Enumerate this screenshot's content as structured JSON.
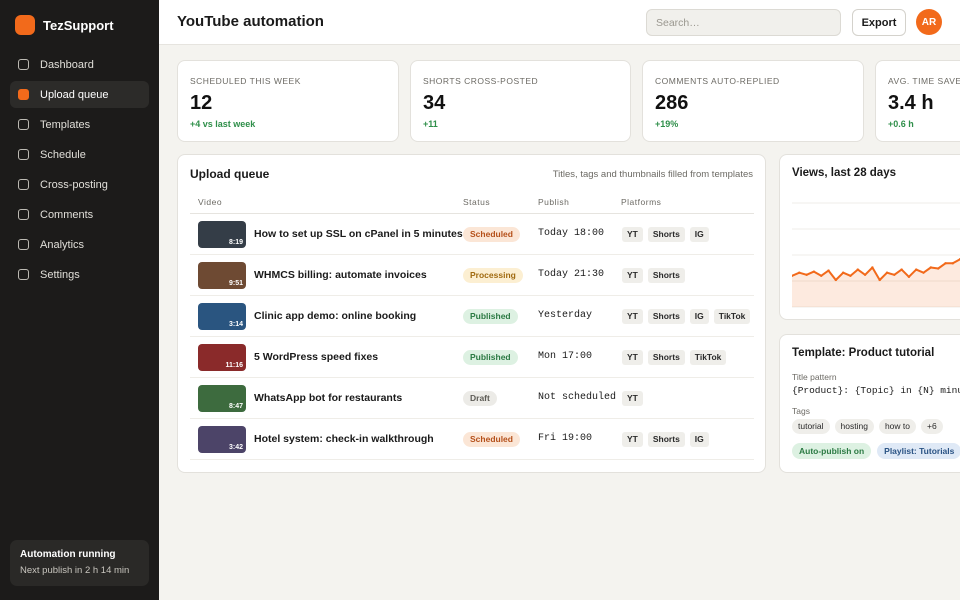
{
  "brand": {
    "name": "TezSupport",
    "accent": "#f26a1b"
  },
  "sidebar": {
    "items": [
      {
        "label": "Dashboard",
        "active": false
      },
      {
        "label": "Upload queue",
        "active": true
      },
      {
        "label": "Templates",
        "active": false
      },
      {
        "label": "Schedule",
        "active": false
      },
      {
        "label": "Cross-posting",
        "active": false
      },
      {
        "label": "Comments",
        "active": false
      },
      {
        "label": "Analytics",
        "active": false
      },
      {
        "label": "Settings",
        "active": false
      }
    ],
    "status": {
      "title": "Automation running",
      "subtitle": "Next publish in 2 h 14 min"
    }
  },
  "header": {
    "title": "YouTube automation",
    "search_placeholder": "Search…",
    "export_label": "Export",
    "avatar_initials": "AR"
  },
  "stats": [
    {
      "label": "Scheduled this week",
      "value": "12",
      "delta": "+4 vs last week"
    },
    {
      "label": "Shorts cross-posted",
      "value": "34",
      "delta": "+11"
    },
    {
      "label": "Comments auto-replied",
      "value": "286",
      "delta": "+19%"
    },
    {
      "label": "Avg. time saved",
      "value": "3.4 h",
      "delta": "+0.6 h"
    }
  ],
  "queue": {
    "title": "Upload queue",
    "note": "Titles, tags and thumbnails filled from templates",
    "columns": [
      "Video",
      "Status",
      "Publish",
      "Platforms"
    ],
    "rows": [
      {
        "title": "How to set up SSL on cPanel in 5 minutes",
        "duration": "8:19",
        "thumb_color": "#343d47",
        "status": "Scheduled",
        "publish": "Today 18:00",
        "platforms": [
          "YT",
          "Shorts",
          "IG"
        ]
      },
      {
        "title": "WHMCS billing: automate invoices",
        "duration": "9:51",
        "thumb_color": "#6e4a33",
        "status": "Processing",
        "publish": "Today 21:30",
        "platforms": [
          "YT",
          "Shorts"
        ]
      },
      {
        "title": "Clinic app demo: online booking",
        "duration": "3:14",
        "thumb_color": "#2a5580",
        "status": "Published",
        "publish": "Yesterday",
        "platforms": [
          "YT",
          "Shorts",
          "IG",
          "TikTok"
        ]
      },
      {
        "title": "5 WordPress speed fixes",
        "duration": "11:16",
        "thumb_color": "#8a2a2a",
        "status": "Published",
        "publish": "Mon 17:00",
        "platforms": [
          "YT",
          "Shorts",
          "TikTok"
        ]
      },
      {
        "title": "WhatsApp bot for restaurants",
        "duration": "8:47",
        "thumb_color": "#3d6b3e",
        "status": "Draft",
        "publish": "Not scheduled",
        "platforms": [
          "YT"
        ]
      },
      {
        "title": "Hotel system: check-in walkthrough",
        "duration": "3:42",
        "thumb_color": "#4c4468",
        "status": "Scheduled",
        "publish": "Fri 19:00",
        "platforms": [
          "YT",
          "Shorts",
          "IG"
        ]
      }
    ]
  },
  "views_card": {
    "title": "Views, last 28 days"
  },
  "chart_data": {
    "type": "area",
    "title": "Views, last 28 days",
    "xlabel": "",
    "ylabel": "",
    "values": [
      30,
      33,
      31,
      34,
      30,
      35,
      26,
      33,
      30,
      36,
      31,
      38,
      26,
      33,
      31,
      36,
      29,
      36,
      33,
      38,
      37,
      42,
      42,
      46,
      45,
      50,
      48
    ],
    "ylim": [
      0,
      100
    ],
    "grid": true,
    "color": "#f26a1b"
  },
  "template_card": {
    "title": "Template: Product tutorial",
    "pattern_label": "Title pattern",
    "pattern": "{Product}: {Topic} in {N} minutes",
    "tags_label": "Tags",
    "tags": [
      "tutorial",
      "hosting",
      "how to",
      "+6"
    ],
    "autopublish": "Auto-publish on",
    "playlist": "Playlist: Tutorials"
  }
}
